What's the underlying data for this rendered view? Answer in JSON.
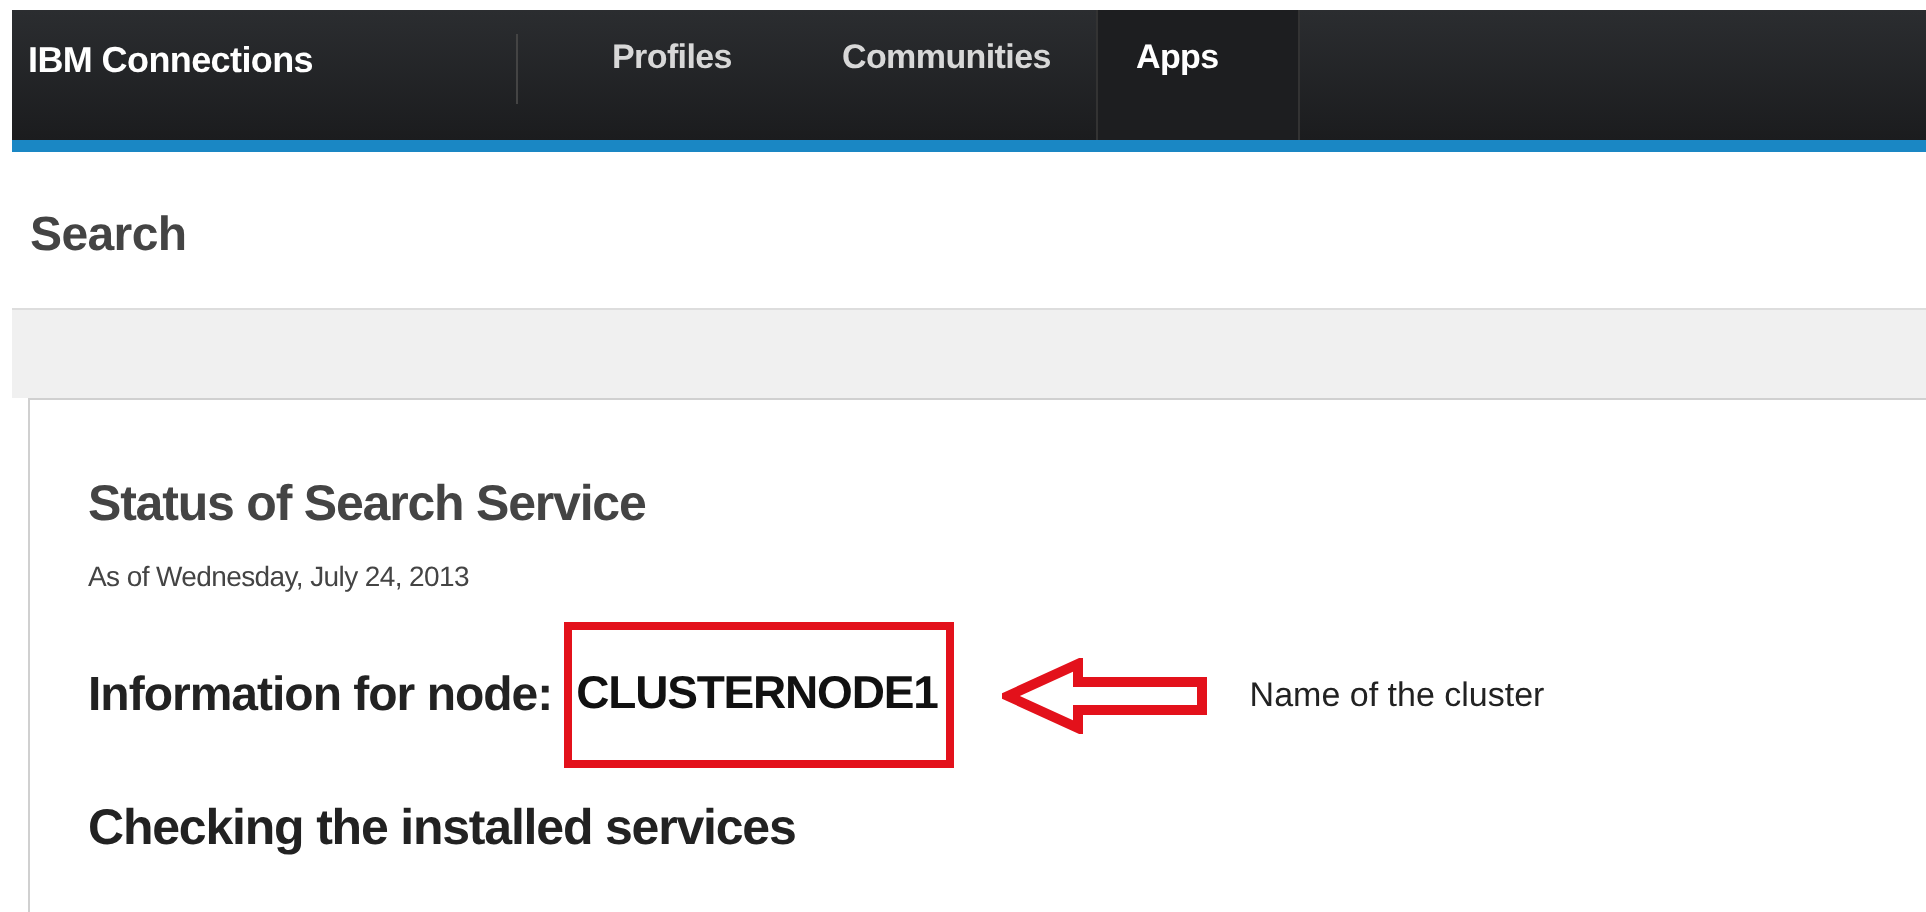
{
  "nav": {
    "brand": "IBM Connections",
    "tabs": [
      {
        "label": "Profiles",
        "selected": false
      },
      {
        "label": "Communities",
        "selected": false
      },
      {
        "label": "Apps",
        "selected": true
      }
    ]
  },
  "page_title": "Search",
  "card": {
    "title": "Status of Search Service",
    "date": "As of Wednesday, July 24, 2013",
    "node_label": "Information for node:",
    "node_name": "CLUSTERNODE1",
    "section": "Checking the installed services"
  },
  "annotation": {
    "note": "Name of the cluster"
  }
}
